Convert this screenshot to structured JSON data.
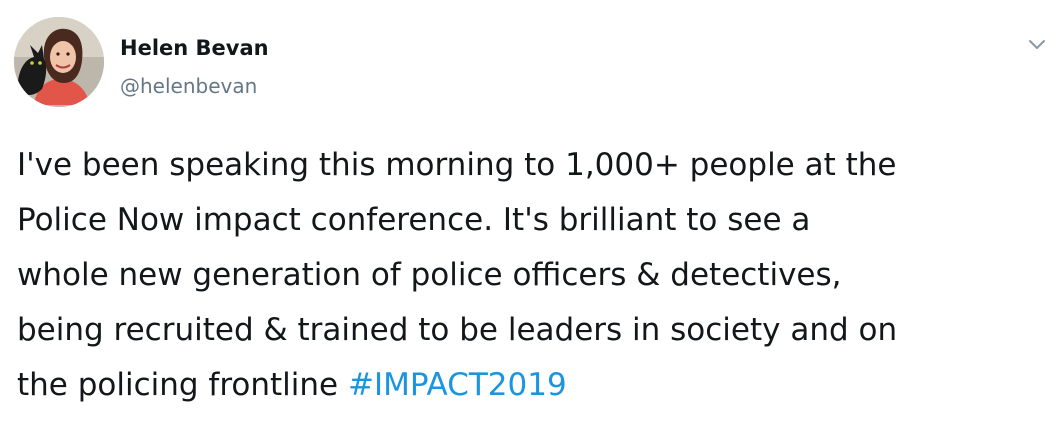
{
  "author": {
    "display_name": "Helen Bevan",
    "handle": "@helenbevan",
    "avatar_icon": "profile-photo"
  },
  "menu": {
    "icon": "chevron-down-icon"
  },
  "tweet": {
    "lines": [
      "I've been speaking this morning to 1,000+ people at the",
      "Police Now impact conference. It's brilliant to see a",
      "whole new generation of police officers & detectives,",
      "being recruited & trained to be leaders in society and on",
      "the policing frontline "
    ],
    "hashtag": "#IMPACT2019"
  },
  "colors": {
    "text": "#14171a",
    "secondary": "#657786",
    "link": "#1b95e0"
  }
}
